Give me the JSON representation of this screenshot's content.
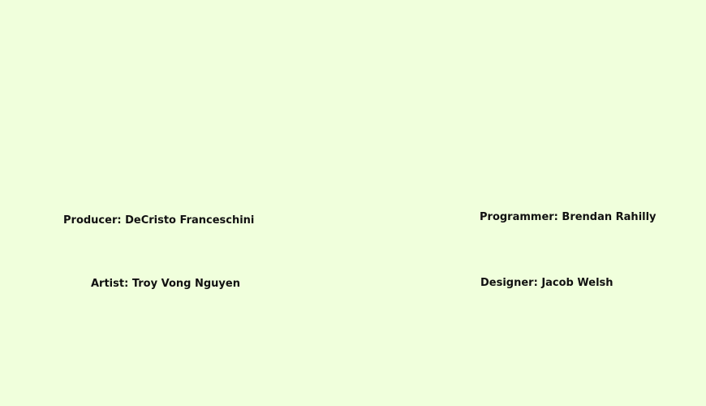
{
  "credits": {
    "producer": "Producer: DeCristo Franceschini",
    "programmer": "Programmer: Brendan Rahilly",
    "artist": "Artist: Troy Vong Nguyen",
    "designer": "Designer: Jacob Welsh"
  },
  "colors": {
    "background": "#f0ffdc",
    "text": "#111111"
  }
}
